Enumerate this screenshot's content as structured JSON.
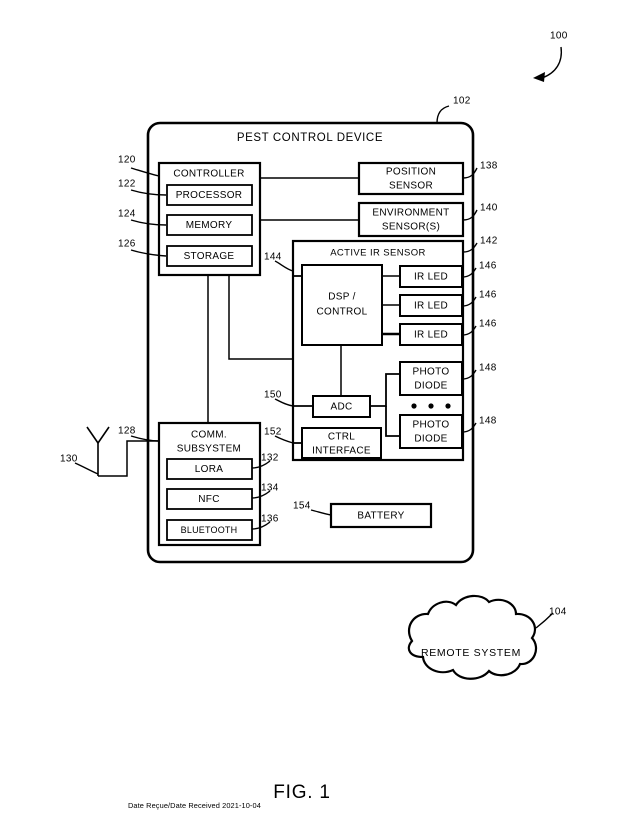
{
  "figure": {
    "caption": "FIG. 1",
    "date_stamp": "Date Reçue/Date Received 2021-10-04",
    "system_ref": "100",
    "device_ref": "102",
    "remote_ref": "104"
  },
  "device": {
    "title": "PEST CONTROL DEVICE",
    "controller": {
      "label": "CONTROLLER",
      "ref": "120",
      "items": [
        {
          "label": "PROCESSOR",
          "ref": "122"
        },
        {
          "label": "MEMORY",
          "ref": "124"
        },
        {
          "label": "STORAGE",
          "ref": "126"
        }
      ]
    },
    "comm": {
      "label_line1": "COMM.",
      "label_line2": "SUBSYSTEM",
      "ref": "128",
      "antenna_ref": "130",
      "items": [
        {
          "label": "LORA",
          "ref": "132"
        },
        {
          "label": "NFC",
          "ref": "134"
        },
        {
          "label": "BLUETOOTH",
          "ref": "136"
        }
      ]
    },
    "sensors": [
      {
        "label_line1": "POSITION",
        "label_line2": "SENSOR",
        "ref": "138"
      },
      {
        "label_line1": "ENVIRONMENT",
        "label_line2": "SENSOR(S)",
        "ref": "140"
      }
    ],
    "ir_sensor": {
      "title": "ACTIVE IR SENSOR",
      "ref": "142",
      "dsp": {
        "label_line1": "DSP /",
        "label_line2": "CONTROL",
        "ref": "144"
      },
      "adc": {
        "label": "ADC",
        "ref": "150"
      },
      "ctrl_interface": {
        "label_line1": "CTRL",
        "label_line2": "INTERFACE",
        "ref": "152"
      },
      "ir_leds": [
        {
          "label": "IR LED",
          "ref": "146"
        },
        {
          "label": "IR LED",
          "ref": "146"
        },
        {
          "label": "IR LED",
          "ref": "146"
        }
      ],
      "photodiodes": [
        {
          "label_line1": "PHOTO",
          "label_line2": "DIODE",
          "ref": "148"
        },
        {
          "label_line1": "PHOTO",
          "label_line2": "DIODE",
          "ref": "148"
        }
      ],
      "ellipsis": "• • •"
    },
    "battery": {
      "label": "BATTERY",
      "ref": "154"
    }
  },
  "remote": {
    "label": "REMOTE SYSTEM"
  },
  "colors": {
    "ink": "#000000",
    "paper": "#ffffff"
  }
}
